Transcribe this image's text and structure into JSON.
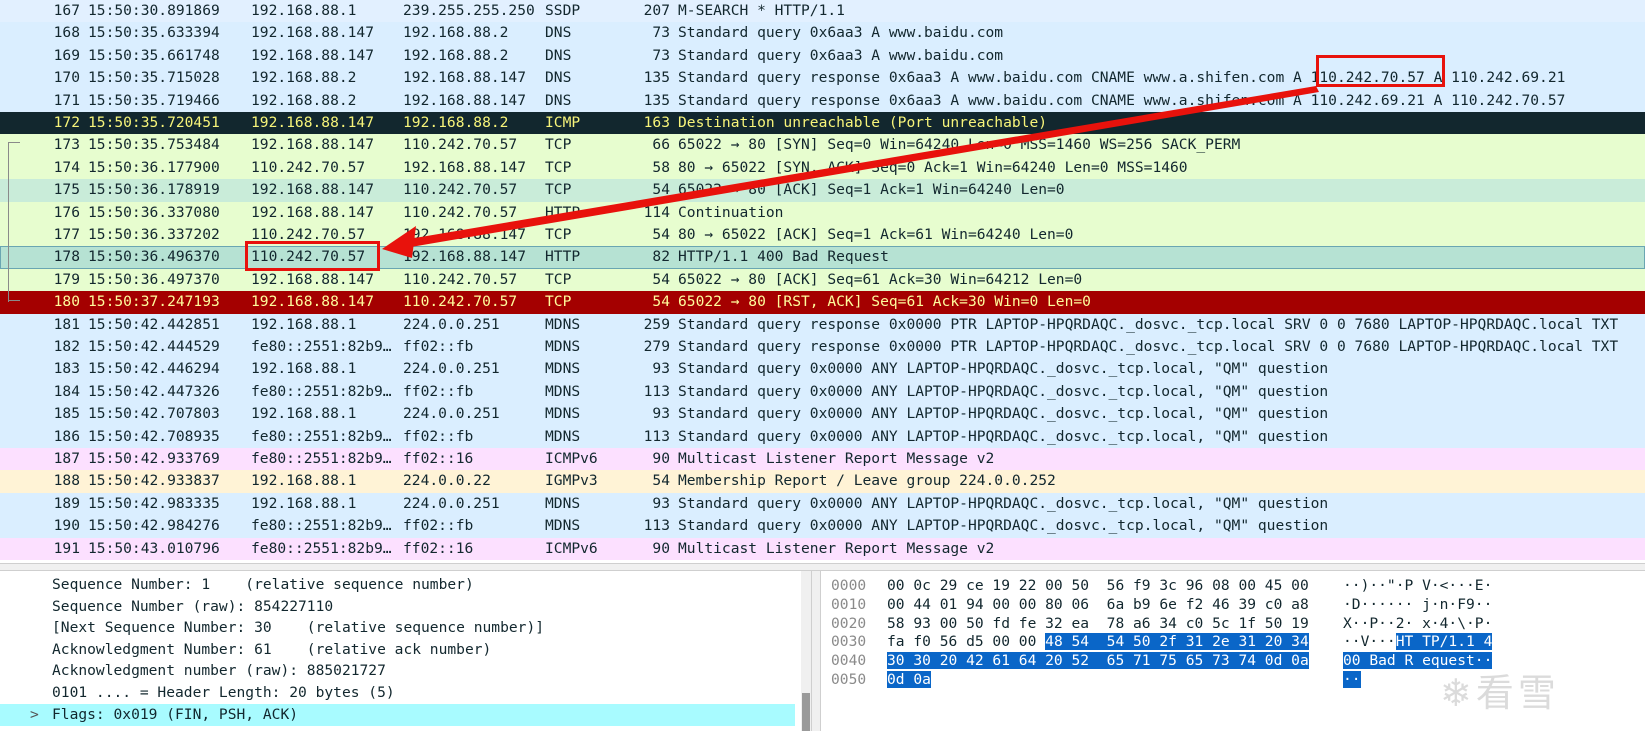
{
  "packets": [
    {
      "no": "167",
      "time": "15:50:30.891869",
      "src": "192.168.88.1",
      "dst": "239.255.255.250",
      "proto": "SSDP",
      "len": "207",
      "info": "M-SEARCH * HTTP/1.1",
      "bg": "#e2f0ff",
      "fg": "#12272e"
    },
    {
      "no": "168",
      "time": "15:50:35.633394",
      "src": "192.168.88.147",
      "dst": "192.168.88.2",
      "proto": "DNS",
      "len": "73",
      "info": "Standard query 0x6aa3 A www.baidu.com",
      "bg": "#daeeff",
      "fg": "#12272e"
    },
    {
      "no": "169",
      "time": "15:50:35.661748",
      "src": "192.168.88.147",
      "dst": "192.168.88.2",
      "proto": "DNS",
      "len": "73",
      "info": "Standard query 0x6aa3 A www.baidu.com",
      "bg": "#daeeff",
      "fg": "#12272e"
    },
    {
      "no": "170",
      "time": "15:50:35.715028",
      "src": "192.168.88.2",
      "dst": "192.168.88.147",
      "proto": "DNS",
      "len": "135",
      "info": "Standard query response 0x6aa3 A www.baidu.com CNAME www.a.shifen.com A 110.242.70.57 A 110.242.69.21",
      "bg": "#daeeff",
      "fg": "#12272e"
    },
    {
      "no": "171",
      "time": "15:50:35.719466",
      "src": "192.168.88.2",
      "dst": "192.168.88.147",
      "proto": "DNS",
      "len": "135",
      "info": "Standard query response 0x6aa3 A www.baidu.com CNAME www.a.shifen.com A 110.242.69.21 A 110.242.70.57",
      "bg": "#daeeff",
      "fg": "#12272e"
    },
    {
      "no": "172",
      "time": "15:50:35.720451",
      "src": "192.168.88.147",
      "dst": "192.168.88.2",
      "proto": "ICMP",
      "len": "163",
      "info": "Destination unreachable (Port unreachable)",
      "bg": "#12272e",
      "fg": "#f7f47a"
    },
    {
      "no": "173",
      "time": "15:50:35.753484",
      "src": "192.168.88.147",
      "dst": "110.242.70.57",
      "proto": "TCP",
      "len": "66",
      "info": "65022 → 80 [SYN] Seq=0 Win=64240 Len=0 MSS=1460 WS=256 SACK_PERM",
      "bg": "#e7fdcf",
      "fg": "#12272e"
    },
    {
      "no": "174",
      "time": "15:50:36.177900",
      "src": "110.242.70.57",
      "dst": "192.168.88.147",
      "proto": "TCP",
      "len": "58",
      "info": "80 → 65022 [SYN, ACK] Seq=0 Ack=1 Win=64240 Len=0 MSS=1460",
      "bg": "#e7fdcf",
      "fg": "#12272e"
    },
    {
      "no": "175",
      "time": "15:50:36.178919",
      "src": "192.168.88.147",
      "dst": "110.242.70.57",
      "proto": "TCP",
      "len": "54",
      "info": "65022 → 80 [ACK] Seq=1 Ack=1 Win=64240 Len=0",
      "bg": "#c9ecd9",
      "fg": "#12272e"
    },
    {
      "no": "176",
      "time": "15:50:36.337080",
      "src": "192.168.88.147",
      "dst": "110.242.70.57",
      "proto": "HTTP",
      "len": "114",
      "info": "Continuation",
      "bg": "#e7fdcf",
      "fg": "#12272e"
    },
    {
      "no": "177",
      "time": "15:50:36.337202",
      "src": "110.242.70.57",
      "dst": "192.168.88.147",
      "proto": "TCP",
      "len": "54",
      "info": "80 → 65022 [ACK] Seq=1 Ack=61 Win=64240 Len=0",
      "bg": "#e7fdcf",
      "fg": "#12272e"
    },
    {
      "no": "178",
      "time": "15:50:36.496370",
      "src": "110.242.70.57",
      "dst": "192.168.88.147",
      "proto": "HTTP",
      "len": "82",
      "info": "HTTP/1.1 400 Bad Request",
      "bg": "#b6e2d3",
      "fg": "#12272e"
    },
    {
      "no": "179",
      "time": "15:50:36.497370",
      "src": "192.168.88.147",
      "dst": "110.242.70.57",
      "proto": "TCP",
      "len": "54",
      "info": "65022 → 80 [ACK] Seq=61 Ack=30 Win=64212 Len=0",
      "bg": "#e7fdcf",
      "fg": "#12272e"
    },
    {
      "no": "180",
      "time": "15:50:37.247193",
      "src": "192.168.88.147",
      "dst": "110.242.70.57",
      "proto": "TCP",
      "len": "54",
      "info": "65022 → 80 [RST, ACK] Seq=61 Ack=30 Win=0 Len=0",
      "bg": "#a40000",
      "fg": "#fffc9c"
    },
    {
      "no": "181",
      "time": "15:50:42.442851",
      "src": "192.168.88.1",
      "dst": "224.0.0.251",
      "proto": "MDNS",
      "len": "259",
      "info": "Standard query response 0x0000 PTR LAPTOP-HPQRDAQC._dosvc._tcp.local SRV 0 0 7680 LAPTOP-HPQRDAQC.local TXT",
      "bg": "#daeeff",
      "fg": "#12272e"
    },
    {
      "no": "182",
      "time": "15:50:42.444529",
      "src": "fe80::2551:82b9…",
      "dst": "ff02::fb",
      "proto": "MDNS",
      "len": "279",
      "info": "Standard query response 0x0000 PTR LAPTOP-HPQRDAQC._dosvc._tcp.local SRV 0 0 7680 LAPTOP-HPQRDAQC.local TXT",
      "bg": "#daeeff",
      "fg": "#12272e"
    },
    {
      "no": "183",
      "time": "15:50:42.446294",
      "src": "192.168.88.1",
      "dst": "224.0.0.251",
      "proto": "MDNS",
      "len": "93",
      "info": "Standard query 0x0000 ANY LAPTOP-HPQRDAQC._dosvc._tcp.local, \"QM\" question",
      "bg": "#daeeff",
      "fg": "#12272e"
    },
    {
      "no": "184",
      "time": "15:50:42.447326",
      "src": "fe80::2551:82b9…",
      "dst": "ff02::fb",
      "proto": "MDNS",
      "len": "113",
      "info": "Standard query 0x0000 ANY LAPTOP-HPQRDAQC._dosvc._tcp.local, \"QM\" question",
      "bg": "#daeeff",
      "fg": "#12272e"
    },
    {
      "no": "185",
      "time": "15:50:42.707803",
      "src": "192.168.88.1",
      "dst": "224.0.0.251",
      "proto": "MDNS",
      "len": "93",
      "info": "Standard query 0x0000 ANY LAPTOP-HPQRDAQC._dosvc._tcp.local, \"QM\" question",
      "bg": "#daeeff",
      "fg": "#12272e"
    },
    {
      "no": "186",
      "time": "15:50:42.708935",
      "src": "fe80::2551:82b9…",
      "dst": "ff02::fb",
      "proto": "MDNS",
      "len": "113",
      "info": "Standard query 0x0000 ANY LAPTOP-HPQRDAQC._dosvc._tcp.local, \"QM\" question",
      "bg": "#daeeff",
      "fg": "#12272e"
    },
    {
      "no": "187",
      "time": "15:50:42.933769",
      "src": "fe80::2551:82b9…",
      "dst": "ff02::16",
      "proto": "ICMPv6",
      "len": "90",
      "info": "Multicast Listener Report Message v2",
      "bg": "#fce0ff",
      "fg": "#12272e"
    },
    {
      "no": "188",
      "time": "15:50:42.933837",
      "src": "192.168.88.1",
      "dst": "224.0.0.22",
      "proto": "IGMPv3",
      "len": "54",
      "info": "Membership Report / Leave group 224.0.0.252",
      "bg": "#fff3d6",
      "fg": "#12272e"
    },
    {
      "no": "189",
      "time": "15:50:42.983335",
      "src": "192.168.88.1",
      "dst": "224.0.0.251",
      "proto": "MDNS",
      "len": "93",
      "info": "Standard query 0x0000 ANY LAPTOP-HPQRDAQC._dosvc._tcp.local, \"QM\" question",
      "bg": "#daeeff",
      "fg": "#12272e"
    },
    {
      "no": "190",
      "time": "15:50:42.984276",
      "src": "fe80::2551:82b9…",
      "dst": "ff02::fb",
      "proto": "MDNS",
      "len": "113",
      "info": "Standard query 0x0000 ANY LAPTOP-HPQRDAQC._dosvc._tcp.local, \"QM\" question",
      "bg": "#daeeff",
      "fg": "#12272e"
    },
    {
      "no": "191",
      "time": "15:50:43.010796",
      "src": "fe80::2551:82b9…",
      "dst": "ff02::16",
      "proto": "ICMPv6",
      "len": "90",
      "info": "Multicast Listener Report Message v2",
      "bg": "#fce0ff",
      "fg": "#12272e"
    }
  ],
  "details": [
    {
      "text": "Sequence Number: 1    (relative sequence number)"
    },
    {
      "text": "Sequence Number (raw): 854227110"
    },
    {
      "text": "[Next Sequence Number: 30    (relative sequence number)]"
    },
    {
      "text": "Acknowledgment Number: 61    (relative ack number)"
    },
    {
      "text": "Acknowledgment number (raw): 885021727"
    },
    {
      "text": "0101 .... = Header Length: 20 bytes (5)"
    },
    {
      "text": "Flags: 0x019 (FIN, PSH, ACK)",
      "expander": ">"
    }
  ],
  "bytes": [
    {
      "offset": "0000",
      "hex_plain": "00 0c 29 ce 19 22 00 50  56 f9 3c 96 08 00 45 00",
      "hex_hl": "",
      "ascii_plain": "··)··\"·P V·<···E·",
      "ascii_hl": ""
    },
    {
      "offset": "0010",
      "hex_plain": "00 44 01 94 00 00 80 06  6a b9 6e f2 46 39 c0 a8",
      "hex_hl": "",
      "ascii_plain": "·D······ j·n·F9··",
      "ascii_hl": ""
    },
    {
      "offset": "0020",
      "hex_plain": "58 93 00 50 fd fe 32 ea  78 a6 34 c0 5c 1f 50 19",
      "hex_hl": "",
      "ascii_plain": "X··P··2· x·4·\\·P·",
      "ascii_hl": ""
    },
    {
      "offset": "0030",
      "hex_plain": "fa f0 56 d5 00 00 ",
      "hex_hl": "48 54  54 50 2f 31 2e 31 20 34",
      "ascii_plain": "··V···",
      "ascii_hl": "HT TP/1.1 4"
    },
    {
      "offset": "0040",
      "hex_plain": "",
      "hex_hl": "30 30 20 42 61 64 20 52  65 71 75 65 73 74 0d 0a",
      "ascii_plain": "",
      "ascii_hl": "00 Bad R equest··"
    },
    {
      "offset": "0050",
      "hex_plain": "",
      "hex_hl": "0d 0a",
      "ascii_plain": "",
      "ascii_hl": "··"
    }
  ],
  "watermark": "看雪",
  "annotation_color": "#e8120c"
}
